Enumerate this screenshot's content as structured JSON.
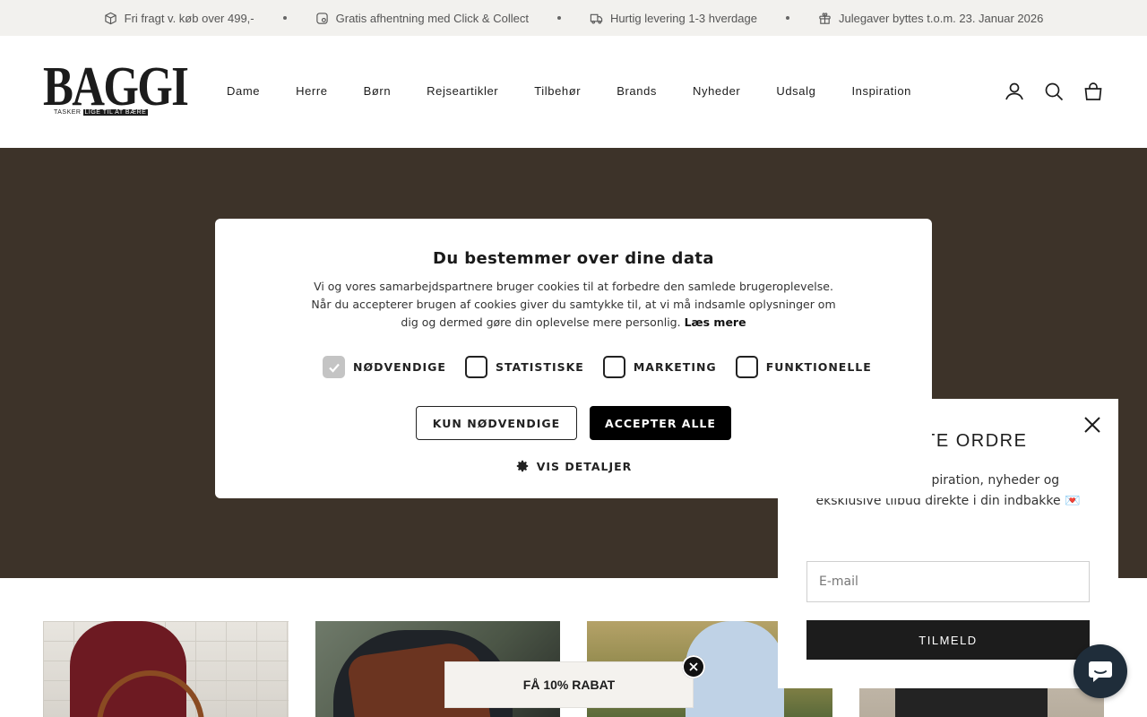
{
  "announcements": [
    {
      "icon": "box-icon",
      "text": "Fri fragt v. køb over 499,-"
    },
    {
      "icon": "tag-icon",
      "text": "Gratis afhentning med Click & Collect"
    },
    {
      "icon": "truck-icon",
      "text": "Hurtig levering 1-3 hverdage"
    },
    {
      "icon": "gift-icon",
      "text": "Julegaver byttes t.o.m. 23. Januar 2026"
    }
  ],
  "logo": {
    "word": "BAGGI",
    "tagline_a": "TASKER",
    "tagline_b": "LIGE TIL AT BÆRE"
  },
  "nav": [
    "Dame",
    "Herre",
    "Børn",
    "Rejseartikler",
    "Tilbehør",
    "Brands",
    "Nyheder",
    "Udsalg",
    "Inspiration"
  ],
  "cookie": {
    "title": "Du bestemmer over dine data",
    "description": "Vi og vores samarbejdspartnere bruger cookies til at forbedre den samlede brugeroplevelse. Når du accepterer brugen af cookies giver du samtykke til, at vi må indsamle oplysninger om dig og dermed gøre din oplevelse mere personlig.",
    "read_more": "Læs mere",
    "checkboxes": [
      {
        "label": "NØDVENDIGE",
        "checked": true
      },
      {
        "label": "STATISTISKE",
        "checked": false
      },
      {
        "label": "MARKETING",
        "checked": false
      },
      {
        "label": "FUNKTIONELLE",
        "checked": false
      }
    ],
    "btn_necessary": "KUN NØDVENDIGE",
    "btn_accept": "ACCEPTER ALLE",
    "details": "VIS DETALJER"
  },
  "newsletter": {
    "title": "FØRSTE ORDRE",
    "body": "at modtage inspiration, nyheder og eksklusive tilbud direkte i din indbakke 💌",
    "email_placeholder": "E-mail",
    "submit": "TILMELD"
  },
  "discount": {
    "label": "FÅ 10% RABAT"
  },
  "colors": {
    "hero": "#3d3329",
    "announce_bg": "#f2f1ee",
    "accent": "#000000",
    "chat": "#1f2d3a"
  }
}
